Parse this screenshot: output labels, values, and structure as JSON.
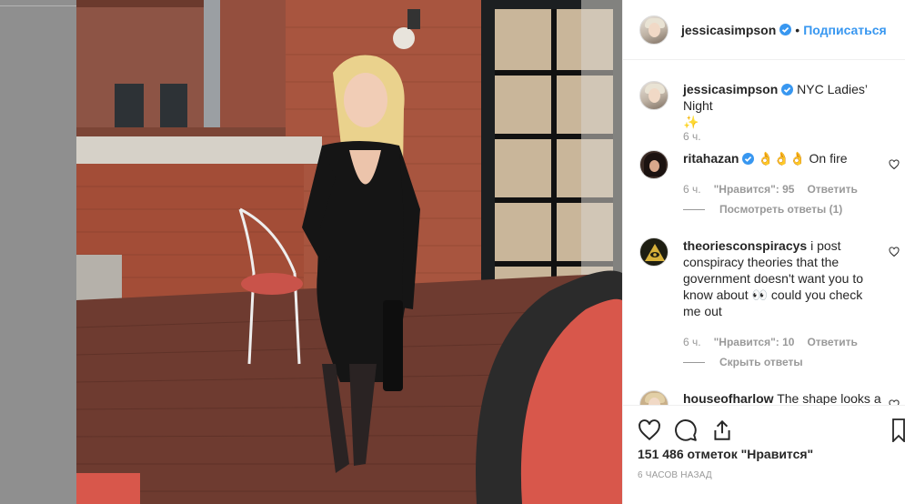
{
  "post": {
    "author": "jessicasimpson",
    "follow_label": "Подписаться",
    "caption_text": "NYC Ladies’ Night",
    "caption_emoji": "✨",
    "caption_time": "6 ч."
  },
  "comments": [
    {
      "user": "ritahazan",
      "verified": true,
      "text": "👌👌👌 On fire",
      "time": "6 ч.",
      "likes": "\"Нравится\": 95",
      "reply_label": "Ответить",
      "view_replies": "Посмотреть ответы (1)"
    },
    {
      "user": "theoriesconspiracys",
      "verified": false,
      "text_lines": [
        "i post",
        "conspiracy theories that the",
        "government doesn't want you to",
        "know about 👀 could you check",
        "me out"
      ],
      "time": "6 ч.",
      "likes": "\"Нравится\": 10",
      "reply_label": "Ответить",
      "view_replies": "Скрыть ответы"
    },
    {
      "user": "houseofharlow",
      "text": "The shape looks a"
    }
  ],
  "footer": {
    "likes_count": "151 486 отметок \"Нравится\"",
    "posted": "6 часов назад"
  },
  "icons": {
    "like": "heart-icon",
    "comment": "comment-icon",
    "share": "share-icon",
    "verified": "verified-badge-icon"
  },
  "colors": {
    "link": "#3897f0",
    "muted": "#999999",
    "text": "#262626"
  }
}
